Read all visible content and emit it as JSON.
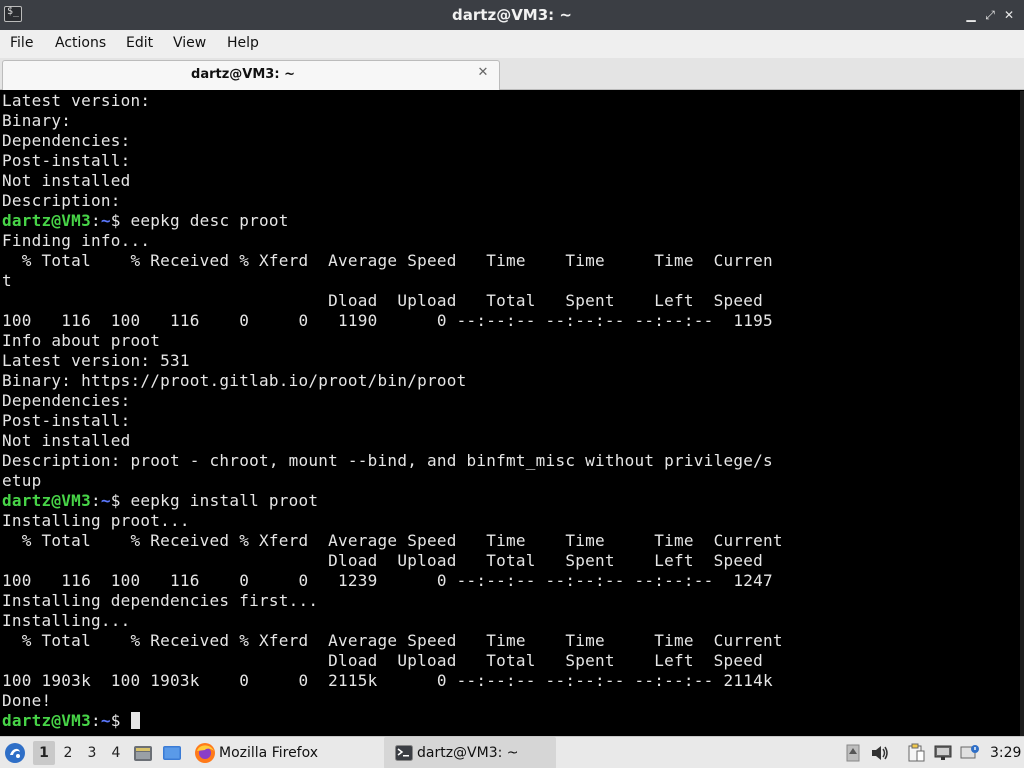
{
  "window": {
    "title": "dartz@VM3: ~",
    "app_icon_glyph": "$_",
    "minimize_glyph": "▁",
    "restore_glyph": "⤢",
    "close_glyph": "✕"
  },
  "menu": {
    "file": "File",
    "actions": "Actions",
    "edit": "Edit",
    "view": "View",
    "help": "Help"
  },
  "tab": {
    "label": "dartz@VM3: ~",
    "close_glyph": "✕"
  },
  "terminal": {
    "prompt_user": "dartz@VM3",
    "prompt_sep": ":",
    "prompt_path": "~",
    "prompt_dollar": "$ ",
    "cmd1": "eepkg desc proot",
    "cmd2": "eepkg install proot",
    "lines": [
      "Latest version:",
      "Binary:",
      "Dependencies:",
      "Post-install:",
      "Not installed",
      "Description:",
      "Finding info...",
      "  % Total    % Received % Xferd  Average Speed   Time    Time     Time  Curren",
      "t",
      "                                 Dload  Upload   Total   Spent    Left  Speed",
      "100   116  100   116    0     0   1190      0 --:--:-- --:--:-- --:--:--  1195",
      "Info about proot",
      "Latest version: 531",
      "Binary: https://proot.gitlab.io/proot/bin/proot",
      "Dependencies:",
      "Post-install:",
      "Not installed",
      "Description: proot - chroot, mount --bind, and binfmt_misc without privilege/s",
      "etup",
      "Installing proot...",
      "  % Total    % Received % Xferd  Average Speed   Time    Time     Time  Current",
      "                                 Dload  Upload   Total   Spent    Left  Speed",
      "100   116  100   116    0     0   1239      0 --:--:-- --:--:-- --:--:--  1247",
      "Installing dependencies first...",
      "Installing...",
      "  % Total    % Received % Xferd  Average Speed   Time    Time     Time  Current",
      "                                 Dload  Upload   Total   Spent    Left  Speed",
      "100 1903k  100 1903k    0     0  2115k      0 --:--:-- --:--:-- --:--:-- 2114k",
      "Done!"
    ]
  },
  "taskbar": {
    "workspaces": [
      "1",
      "2",
      "3",
      "4"
    ],
    "active_workspace": "1",
    "firefox_label": "Mozilla Firefox",
    "terminal_label": "dartz@VM3: ~",
    "clock": "3:29"
  },
  "colors": {
    "prompt_user": "#47d447",
    "prompt_path": "#5c79ff",
    "terminal_bg": "#000000",
    "terminal_fg": "#e6e6e6"
  }
}
